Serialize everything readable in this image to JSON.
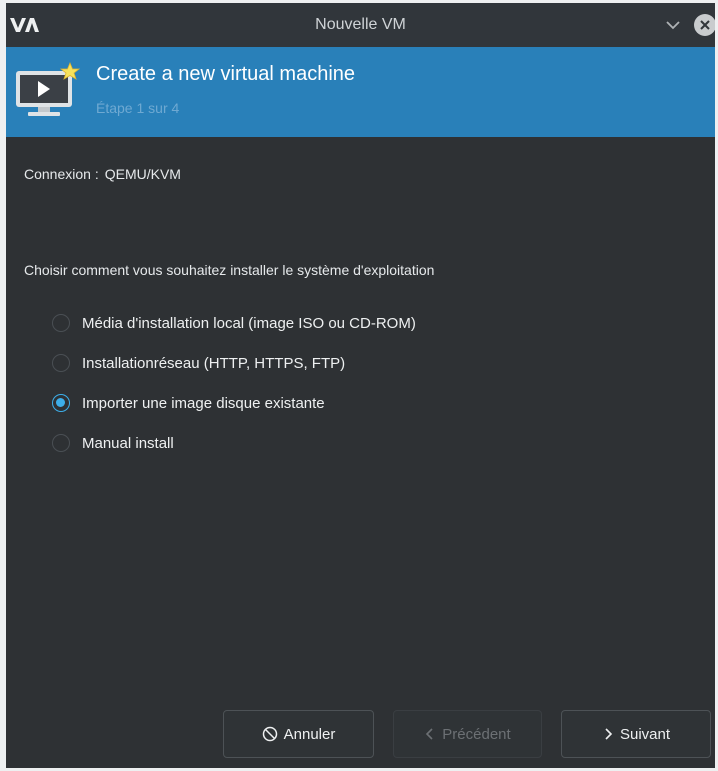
{
  "window": {
    "title": "Nouvelle VM"
  },
  "header": {
    "title": "Create a new virtual machine",
    "subtitle": "Étape 1 sur 4"
  },
  "connection": {
    "label": "Connexion :",
    "value": "QEMU/KVM"
  },
  "install": {
    "prompt": "Choisir comment vous souhaitez installer le système d'exploitation",
    "options": [
      {
        "label": "Média d'installation local (image ISO ou CD-ROM)",
        "checked": false
      },
      {
        "label": "Installationréseau (HTTP, HTTPS, FTP)",
        "checked": false
      },
      {
        "label": "Importer une image disque existante",
        "checked": true
      },
      {
        "label": "Manual install",
        "checked": false
      }
    ]
  },
  "buttons": {
    "cancel": "Annuler",
    "previous": "Précédent",
    "next": "Suivant"
  },
  "icons": {
    "app_logo": "virt-manager-logo-icon",
    "chevron": "chevron-down-icon",
    "close": "close-icon",
    "vm": "virtual-machine-new-icon",
    "cancel": "cancel-circle-icon",
    "previous": "chevron-left-icon",
    "next": "chevron-right-icon"
  },
  "colors": {
    "accent": "#2980b9",
    "selection": "#3daee9",
    "background": "#2e3134",
    "titlebar": "#31363b"
  }
}
